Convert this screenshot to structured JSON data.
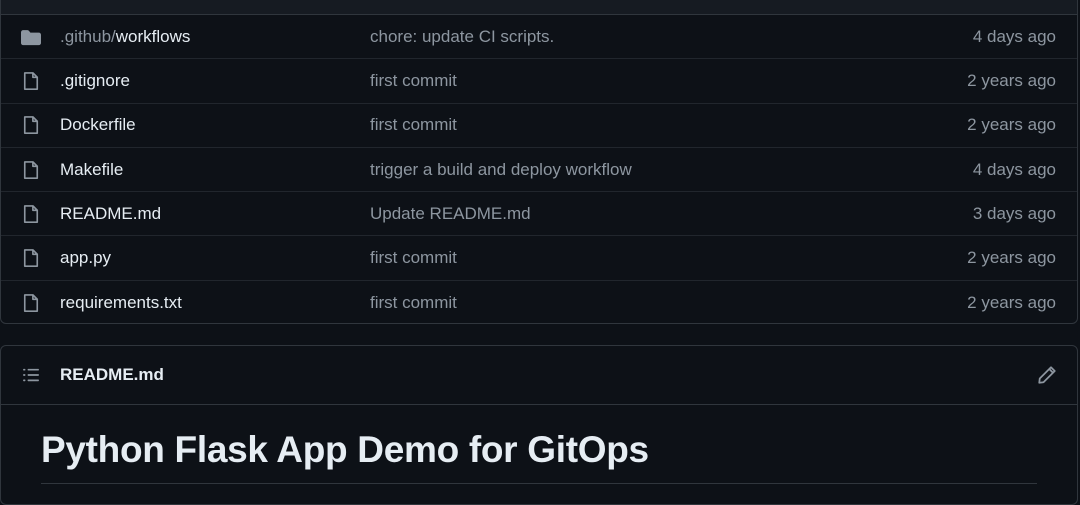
{
  "files": [
    {
      "icon": "folder-icon",
      "name_prefix": ".github/",
      "name": "workflows",
      "commit": "chore: update CI scripts.",
      "time": "4 days ago"
    },
    {
      "icon": "file-icon",
      "name_prefix": "",
      "name": ".gitignore",
      "commit": "first commit",
      "time": "2 years ago"
    },
    {
      "icon": "file-icon",
      "name_prefix": "",
      "name": "Dockerfile",
      "commit": "first commit",
      "time": "2 years ago"
    },
    {
      "icon": "file-icon",
      "name_prefix": "",
      "name": "Makefile",
      "commit": "trigger a build and deploy workflow",
      "time": "4 days ago"
    },
    {
      "icon": "file-icon",
      "name_prefix": "",
      "name": "README.md",
      "commit": "Update README.md",
      "time": "3 days ago"
    },
    {
      "icon": "file-icon",
      "name_prefix": "",
      "name": "app.py",
      "commit": "first commit",
      "time": "2 years ago"
    },
    {
      "icon": "file-icon",
      "name_prefix": "",
      "name": "requirements.txt",
      "commit": "first commit",
      "time": "2 years ago"
    }
  ],
  "readme": {
    "title": "README.md",
    "heading": "Python Flask App Demo for GitOps"
  },
  "colors": {
    "background": "#0d1117",
    "border": "#30363d",
    "text": "#e6edf3",
    "muted": "#8d96a0"
  }
}
